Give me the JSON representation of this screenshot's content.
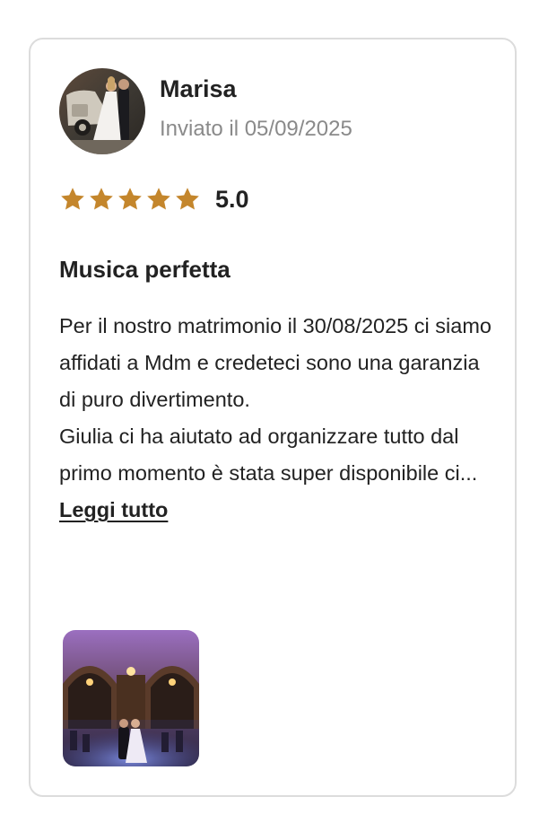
{
  "review": {
    "author": "Marisa",
    "sent": "Inviato il 05/09/2025",
    "rating": 5,
    "rating_text": "5.0",
    "star_color": "#c4862c",
    "title": "Musica perfetta",
    "body_paragraph_1": "Per il nostro matrimonio il 30/08/2025 ci siamo affidati a Mdm e credeteci sono una garanzia di puro divertimento.",
    "body_paragraph_2": "Giulia ci ha aiutato ad organizzare tutto dal primo momento è stata super disponibile ci...",
    "read_more_label": "Leggi tutto",
    "photos_count": 1
  }
}
